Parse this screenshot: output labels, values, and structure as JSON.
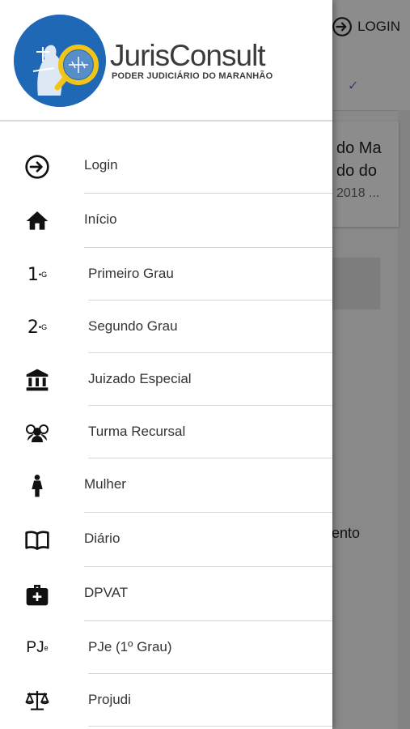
{
  "background": {
    "login_label": "LOGIN",
    "card_line1": "do Ma",
    "card_line2": "do do",
    "card_line3": "2018 ...",
    "fragment_text": "ento"
  },
  "logo": {
    "title": "JurisConsult",
    "subtitle": "PODER JUDICIÁRIO DO MARANHÃO"
  },
  "menu": {
    "items": [
      {
        "label": "Login",
        "icon": "login-icon"
      },
      {
        "label": "Início",
        "icon": "home-icon"
      },
      {
        "label": "Primeiro Grau",
        "icon": "first-degree-icon",
        "icon_text": "1"
      },
      {
        "label": "Segundo Grau",
        "icon": "second-degree-icon",
        "icon_text": "2"
      },
      {
        "label": "Juizado Especial",
        "icon": "courthouse-icon"
      },
      {
        "label": "Turma Recursal",
        "icon": "group-icon"
      },
      {
        "label": "Mulher",
        "icon": "woman-icon"
      },
      {
        "label": "Diário",
        "icon": "book-icon"
      },
      {
        "label": "DPVAT",
        "icon": "medical-kit-icon"
      },
      {
        "label": "PJe (1º Grau)",
        "icon": "pje-icon",
        "icon_text": "PJ"
      },
      {
        "label": "Projudi",
        "icon": "scales-icon"
      }
    ]
  },
  "colors": {
    "brand_blue": "#1f68b5",
    "brand_gold": "#f2c318",
    "scrim": "rgba(0,0,0,0.45)"
  }
}
